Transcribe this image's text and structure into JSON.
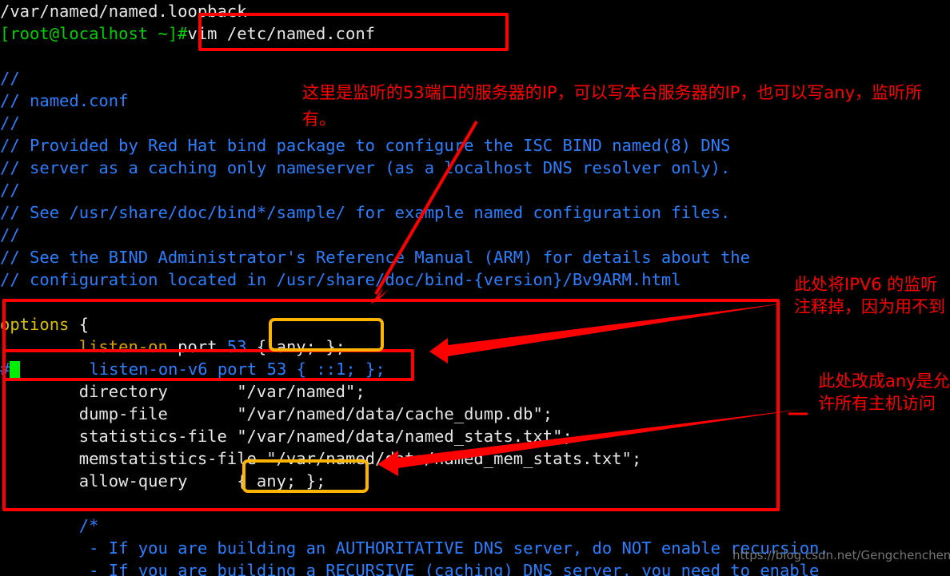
{
  "terminal": {
    "lines": [
      {
        "id": "prev-output",
        "segments": [
          {
            "text": "/var/named/named.loopback",
            "color": "white"
          }
        ]
      },
      {
        "id": "prompt-line",
        "segments": [
          {
            "text": "[root@localhost ~]#",
            "color": "green"
          },
          {
            "text": "vim /etc/named.conf",
            "color": "white"
          }
        ]
      },
      {
        "id": "blank-1",
        "segments": [
          {
            "text": "",
            "color": "white"
          }
        ]
      },
      {
        "id": "comment-1",
        "segments": [
          {
            "text": "//",
            "color": "blue"
          }
        ]
      },
      {
        "id": "comment-2",
        "segments": [
          {
            "text": "// named.conf",
            "color": "blue"
          }
        ]
      },
      {
        "id": "comment-3",
        "segments": [
          {
            "text": "//",
            "color": "blue"
          }
        ]
      },
      {
        "id": "comment-4",
        "segments": [
          {
            "text": "// Provided by Red Hat bind package to configure the ISC BIND named(8) DNS",
            "color": "blue"
          }
        ]
      },
      {
        "id": "comment-5",
        "segments": [
          {
            "text": "// server as a caching only nameserver (as a localhost DNS resolver only).",
            "color": "blue"
          }
        ]
      },
      {
        "id": "comment-6",
        "segments": [
          {
            "text": "//",
            "color": "blue"
          }
        ]
      },
      {
        "id": "comment-7",
        "segments": [
          {
            "text": "// See /usr/share/doc/bind*/sample/ for example named configuration files.",
            "color": "blue"
          }
        ]
      },
      {
        "id": "comment-8",
        "segments": [
          {
            "text": "//",
            "color": "blue"
          }
        ]
      },
      {
        "id": "comment-9",
        "segments": [
          {
            "text": "// See the BIND Administrator's Reference Manual (ARM) for details about the",
            "color": "blue"
          }
        ]
      },
      {
        "id": "comment-10",
        "segments": [
          {
            "text": "// configuration located in /usr/share/doc/bind-{version}/Bv9ARM.html",
            "color": "blue"
          }
        ]
      },
      {
        "id": "blank-2",
        "segments": [
          {
            "text": "",
            "color": "white"
          }
        ]
      },
      {
        "id": "options-open",
        "segments": [
          {
            "text": "options",
            "color": "yellow"
          },
          {
            "text": " {",
            "color": "white"
          }
        ]
      },
      {
        "id": "listen-on",
        "segments": [
          {
            "text": "        ",
            "color": "white"
          },
          {
            "text": "listen-on",
            "color": "orange"
          },
          {
            "text": " port ",
            "color": "white"
          },
          {
            "text": "53",
            "color": "blue"
          },
          {
            "text": " { any; };",
            "color": "white"
          }
        ]
      },
      {
        "id": "listen-on-v6",
        "segments": [
          {
            "text": "#",
            "color": "blue"
          },
          {
            "text": "█",
            "color": "cursor"
          },
          {
            "text": "       listen-on-v6 port 53 { ::1; };",
            "color": "blue"
          }
        ]
      },
      {
        "id": "directory",
        "segments": [
          {
            "text": "        directory       \"/var/named\";",
            "color": "white"
          }
        ]
      },
      {
        "id": "dump-file",
        "segments": [
          {
            "text": "        dump-file       \"/var/named/data/cache_dump.db\";",
            "color": "white"
          }
        ]
      },
      {
        "id": "statistics",
        "segments": [
          {
            "text": "        statistics-file \"/var/named/data/named_stats.txt\";",
            "color": "white"
          }
        ]
      },
      {
        "id": "memstatistics",
        "segments": [
          {
            "text": "        memstatistics-file \"/var/named/data/named_mem_stats.txt\";",
            "color": "white"
          }
        ]
      },
      {
        "id": "allow-query",
        "segments": [
          {
            "text": "        allow-query     { any; };",
            "color": "white"
          }
        ]
      },
      {
        "id": "blank-3",
        "segments": [
          {
            "text": "",
            "color": "white"
          }
        ]
      },
      {
        "id": "block-open",
        "segments": [
          {
            "text": "        /*",
            "color": "blue"
          }
        ]
      },
      {
        "id": "block-1",
        "segments": [
          {
            "text": "         - If you are building an AUTHORITATIVE DNS server, do NOT enable recursion.",
            "color": "blue"
          }
        ]
      },
      {
        "id": "block-2",
        "segments": [
          {
            "text": "         - If you are building a RECURSIVE (caching) DNS server, you need to enable",
            "color": "blue"
          }
        ]
      }
    ]
  },
  "annotations": {
    "top_note": "这里是监听的53端口的服务器的IP，可以写本台服务器的IP，也可以写any，监听所有。",
    "right_note_1": "此处将IPV6 的监听注释掉，因为用不到",
    "right_note_2": "此处改成any是允许所有主机访问"
  },
  "watermark": {
    "text": "https://blog.csdn.net/Gengchenchen"
  },
  "colors": {
    "annotation_red": "#ff0000",
    "highlight_yellow": "#ffb400",
    "terminal_background": "#000000",
    "comment_blue": "#2a7fff",
    "prompt_green": "#00d000",
    "keyword_yellow": "#d8c000",
    "cursor_green": "#00ee00"
  }
}
